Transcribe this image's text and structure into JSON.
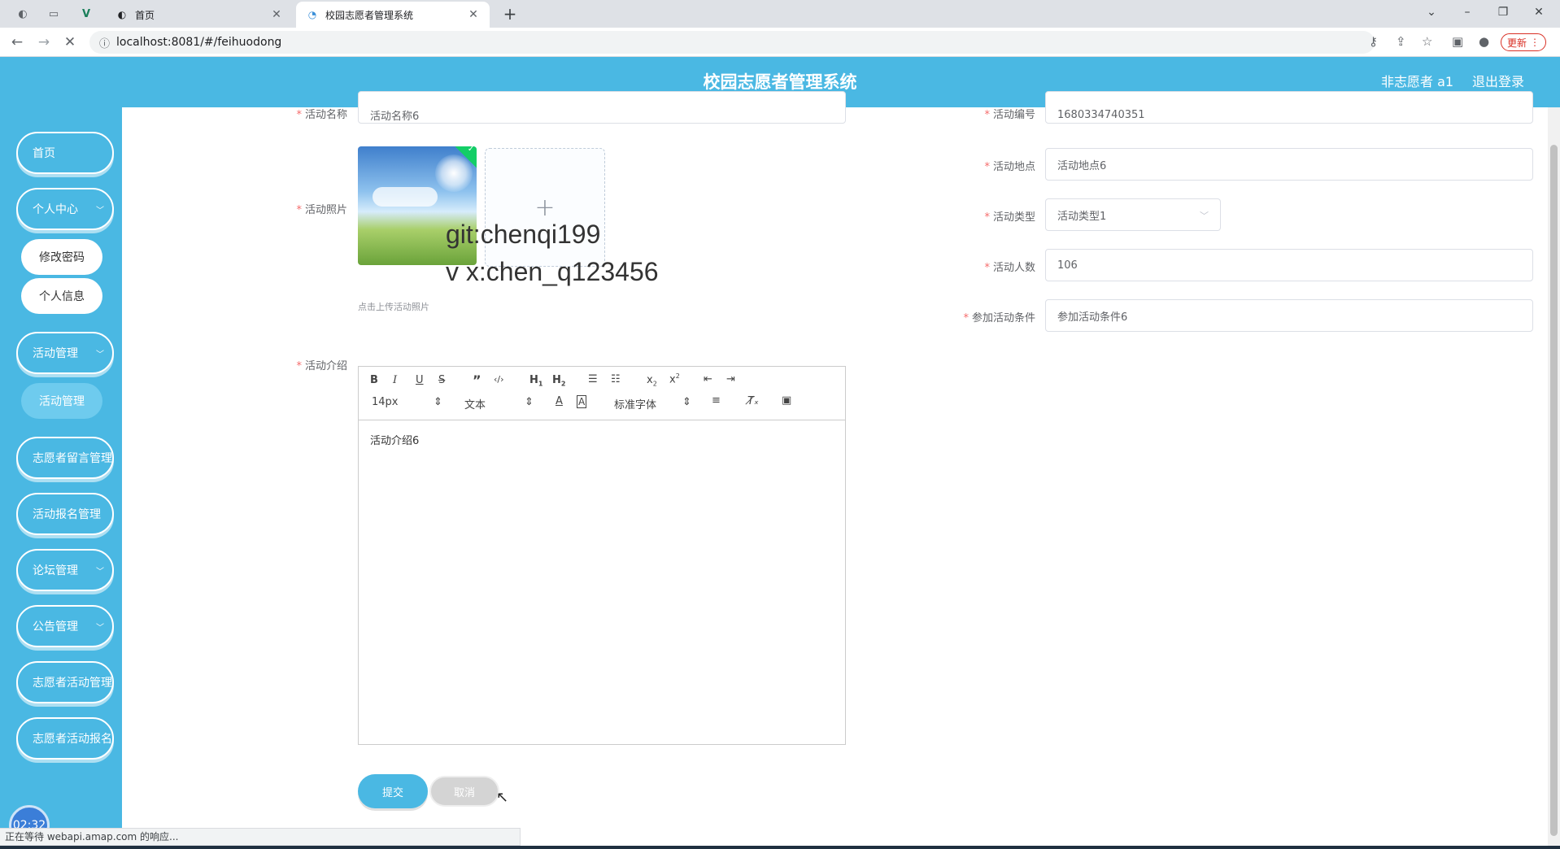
{
  "browser": {
    "tabs": [
      {
        "title": "首页",
        "active": false
      },
      {
        "title": "校园志愿者管理系统",
        "active": true
      }
    ],
    "url": "localhost:8081/#/feihuodong",
    "update_label": "更新",
    "status_text": "正在等待 webapi.amap.com 的响应..."
  },
  "header": {
    "title": "校园志愿者管理系统",
    "user": "非志愿者 a1",
    "logout": "退出登录"
  },
  "sidebar": {
    "items": [
      {
        "label": "首页",
        "has_arrow": false
      },
      {
        "label": "个人中心",
        "has_arrow": true
      },
      {
        "label": "活动管理",
        "has_arrow": true
      },
      {
        "label": "志愿者留言管理",
        "has_arrow": true
      },
      {
        "label": "活动报名管理",
        "has_arrow": true
      },
      {
        "label": "论坛管理",
        "has_arrow": true
      },
      {
        "label": "公告管理",
        "has_arrow": true
      },
      {
        "label": "志愿者活动管理",
        "has_arrow": true
      },
      {
        "label": "志愿者活动报名管理",
        "has_arrow": true
      }
    ],
    "sub_items": {
      "personal": [
        "修改密码",
        "个人信息"
      ],
      "activity": [
        "活动管理"
      ]
    },
    "clock": "02:32"
  },
  "form": {
    "name": {
      "label": "活动名称",
      "value": "活动名称6"
    },
    "code": {
      "label": "活动编号",
      "value": "1680334740351"
    },
    "photo": {
      "label": "活动照片",
      "hint": "点击上传活动照片",
      "upload_icon": "+"
    },
    "location": {
      "label": "活动地点",
      "value": "活动地点6"
    },
    "type": {
      "label": "活动类型",
      "value": "活动类型1"
    },
    "count": {
      "label": "活动人数",
      "value": "106"
    },
    "condition": {
      "label": "参加活动条件",
      "value": "参加活动条件6"
    },
    "intro": {
      "label": "活动介绍",
      "value": "活动介绍6"
    },
    "required_mark": "*"
  },
  "editor": {
    "size_select": "14px",
    "header_select": "文本",
    "font_select": "标准字体"
  },
  "watermark": {
    "line1": "git:chenqi199",
    "line2": "v x:chen_q123456"
  },
  "buttons": {
    "submit": "提交",
    "cancel": "取消"
  },
  "colors": {
    "primary": "#4ab8e3",
    "required": "#f56c6c",
    "success": "#13ce66"
  }
}
